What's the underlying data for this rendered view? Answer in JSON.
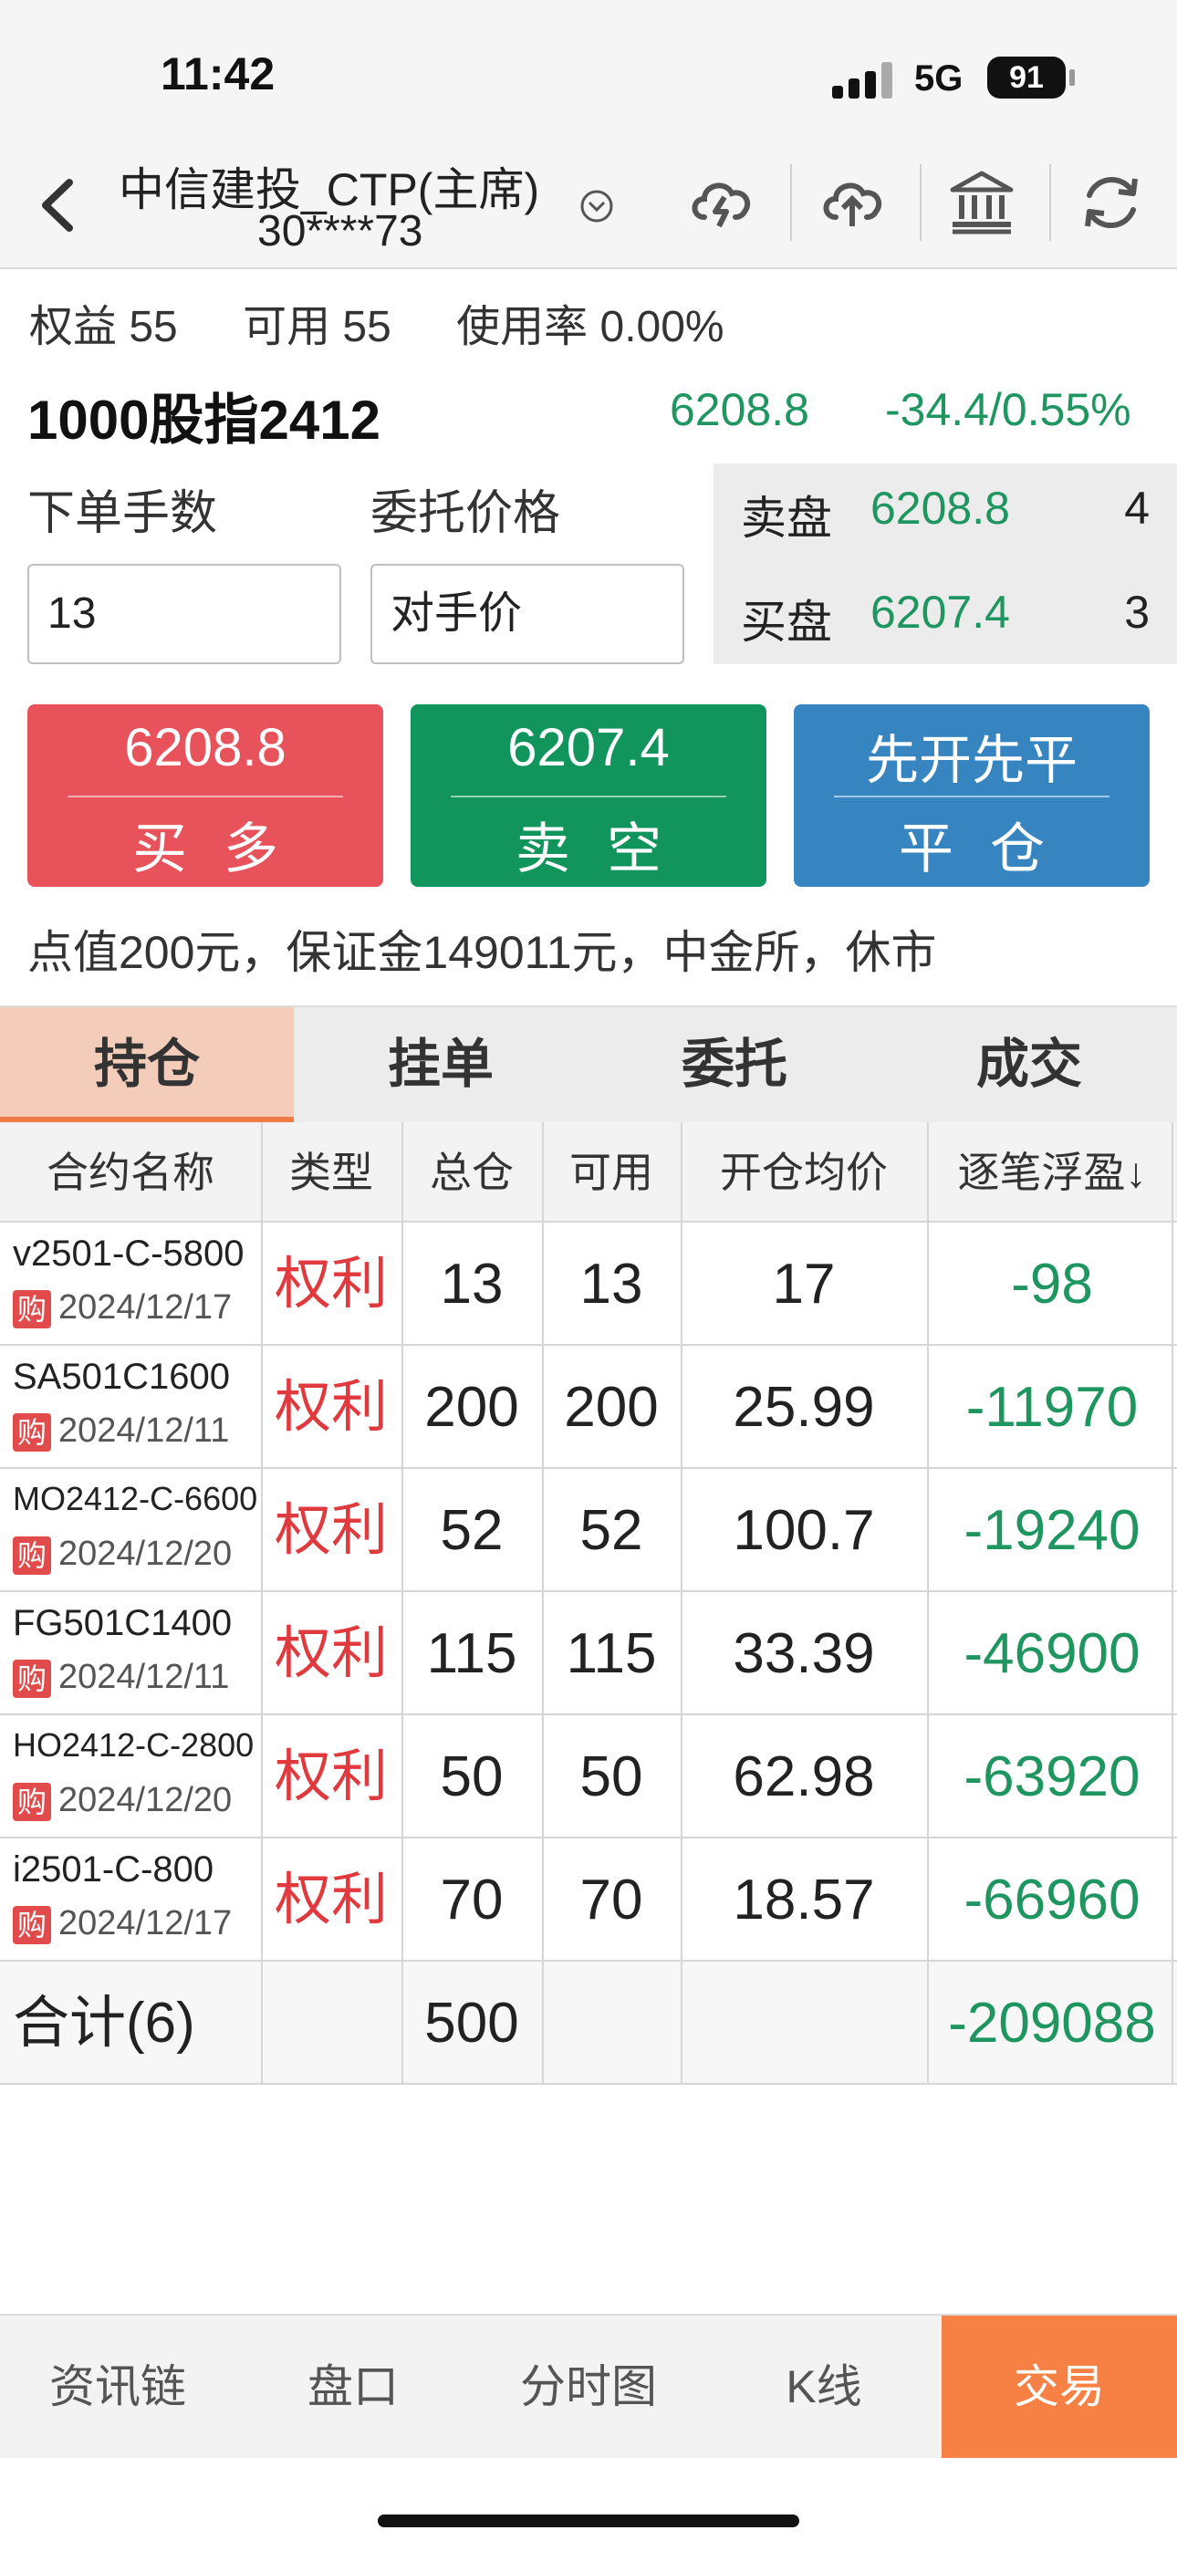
{
  "status_bar": {
    "time": "11:42",
    "network": "5G",
    "battery": "91"
  },
  "nav": {
    "title": "中信建投_CTP(主席)",
    "account": "30****73",
    "icons": [
      "back-icon",
      "cloud-lightning-icon",
      "cloud-upload-icon",
      "bank-icon",
      "refresh-icon"
    ]
  },
  "account": {
    "equity": "权益 55",
    "available": "可用 55",
    "usage": "使用率 0.00%"
  },
  "contract": {
    "name": "1000股指2412",
    "price": "6208.8",
    "change": "-34.4/0.55%"
  },
  "order": {
    "qty_label": "下单手数",
    "price_label": "委托价格",
    "qty_value": "13",
    "price_value": "对手价"
  },
  "quote": {
    "ask_label": "卖盘",
    "ask_price": "6208.8",
    "ask_qty": "4",
    "bid_label": "买盘",
    "bid_price": "6207.4",
    "bid_qty": "3"
  },
  "buttons": {
    "buy_price": "6208.8",
    "buy_label": "买多",
    "sell_price": "6207.4",
    "sell_label": "卖空",
    "close_top": "先开先平",
    "close_label": "平仓"
  },
  "info_line": "点值200元，保证金149011元，中金所，休市",
  "tabs": [
    "持仓",
    "挂单",
    "委托",
    "成交"
  ],
  "table": {
    "headers": [
      "合约名称",
      "类型",
      "总仓",
      "可用",
      "开仓均价",
      "逐笔浮盈↓"
    ],
    "rows": [
      {
        "name": "v2501-C-5800",
        "tag": "购",
        "date": "2024/12/17",
        "type": "权利",
        "total": "13",
        "avail": "13",
        "avg": "17",
        "pl": "-98"
      },
      {
        "name": "SA501C1600",
        "tag": "购",
        "date": "2024/12/11",
        "type": "权利",
        "total": "200",
        "avail": "200",
        "avg": "25.99",
        "pl": "-11970"
      },
      {
        "name": "MO2412-C-6600",
        "tag": "购",
        "date": "2024/12/20",
        "type": "权利",
        "total": "52",
        "avail": "52",
        "avg": "100.7",
        "pl": "-19240"
      },
      {
        "name": "FG501C1400",
        "tag": "购",
        "date": "2024/12/11",
        "type": "权利",
        "total": "115",
        "avail": "115",
        "avg": "33.39",
        "pl": "-46900"
      },
      {
        "name": "HO2412-C-2800",
        "tag": "购",
        "date": "2024/12/20",
        "type": "权利",
        "total": "50",
        "avail": "50",
        "avg": "62.98",
        "pl": "-63920"
      },
      {
        "name": "i2501-C-800",
        "tag": "购",
        "date": "2024/12/17",
        "type": "权利",
        "total": "70",
        "avail": "70",
        "avg": "18.57",
        "pl": "-66960"
      }
    ],
    "total": {
      "label": "合计(6)",
      "total": "500",
      "pl": "-209088"
    }
  },
  "bottom_nav": [
    "资讯链",
    "盘口",
    "分时图",
    "K线",
    "交易"
  ],
  "colors": {
    "green": "#1f9560",
    "red": "#e8525a",
    "blue": "#3685c0",
    "orange": "#f78045"
  }
}
